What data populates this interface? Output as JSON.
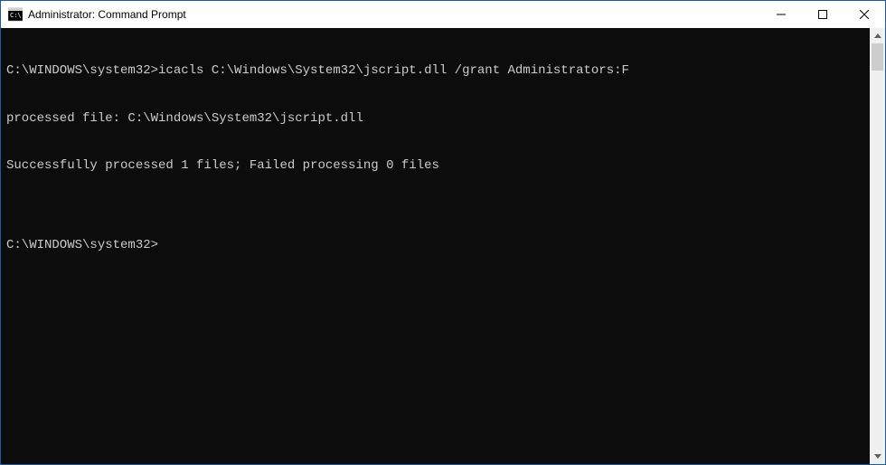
{
  "window": {
    "title": "Administrator: Command Prompt"
  },
  "console": {
    "lines": [
      {
        "prompt": "C:\\WINDOWS\\system32>",
        "command": "icacls C:\\Windows\\System32\\jscript.dll /grant Administrators:F"
      },
      {
        "text": "processed file: C:\\Windows\\System32\\jscript.dll"
      },
      {
        "text": "Successfully processed 1 files; Failed processing 0 files"
      },
      {
        "text": ""
      },
      {
        "prompt": "C:\\WINDOWS\\system32>",
        "command": ""
      }
    ]
  }
}
